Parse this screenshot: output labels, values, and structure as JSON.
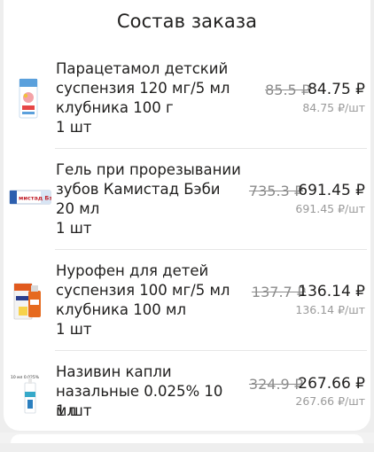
{
  "title": "Состав заказа",
  "items": [
    {
      "name": "Парацетамол детский суспензия 120 мг/5 мл клубника 100 г",
      "qty": "1 шт",
      "old_price": "85.5 ₽",
      "new_price": "84.75 ₽",
      "unit_price": "84.75 ₽/шт",
      "image": "paracetamol-box-icon"
    },
    {
      "name": "Гель при прорезывании зубов Камистад Бэби 20 мл",
      "qty": "1 шт",
      "old_price": "735.3 ₽",
      "new_price": "691.45 ₽",
      "unit_price": "691.45 ₽/шт",
      "image": "kamistad-tube-icon",
      "image_label": "мистад Бэби"
    },
    {
      "name": "Нурофен для детей суспензия 100 мг/5 мл клубника 100 мл",
      "qty": "1 шт",
      "old_price": "137.7 ₽",
      "new_price": "136.14 ₽",
      "unit_price": "136.14 ₽/шт",
      "image": "nurofen-box-icon"
    },
    {
      "name": "Називин капли назальные 0.025% 10 мл",
      "qty": "1 шт",
      "old_price": "324.9 ₽",
      "new_price": "267.66 ₽",
      "unit_price": "267.66 ₽/шт",
      "image": "nazivin-box-icon",
      "image_label": "10 мл 0.025%"
    }
  ]
}
